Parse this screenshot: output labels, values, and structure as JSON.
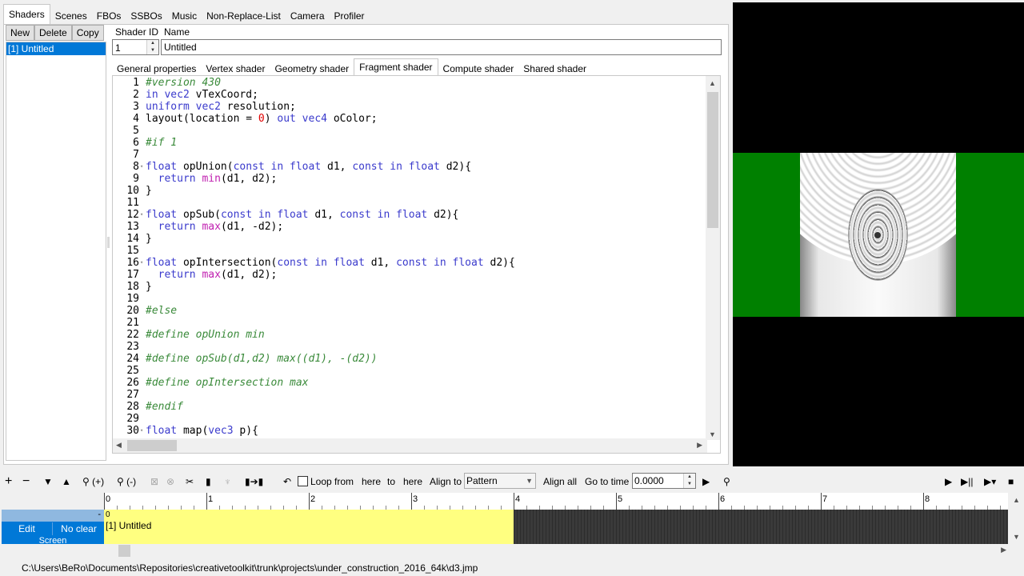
{
  "main_tabs": [
    "Shaders",
    "Scenes",
    "FBOs",
    "SSBOs",
    "Music",
    "Non-Replace-List",
    "Camera",
    "Profiler"
  ],
  "main_tab_active": "Shaders",
  "list_buttons": {
    "new": "New",
    "delete": "Delete",
    "copy": "Copy"
  },
  "shader_list": [
    "[1] Untitled"
  ],
  "header": {
    "shader_id_label": "Shader ID",
    "name_label": "Name",
    "shader_id_value": "1",
    "name_value": "Untitled"
  },
  "sub_tabs": [
    "General properties",
    "Vertex shader",
    "Geometry shader",
    "Fragment shader",
    "Compute shader",
    "Shared shader"
  ],
  "sub_tab_active": "Fragment shader",
  "code_lines": [
    [
      [
        "pp",
        "#version 430"
      ]
    ],
    [
      [
        "kw",
        "in vec2 "
      ],
      [
        "plain",
        "vTexCoord;"
      ]
    ],
    [
      [
        "kw",
        "uniform vec2 "
      ],
      [
        "plain",
        "resolution;"
      ]
    ],
    [
      [
        "plain",
        "layout(location = "
      ],
      [
        "num",
        "0"
      ],
      [
        "plain",
        ") "
      ],
      [
        "kw",
        "out vec4 "
      ],
      [
        "plain",
        "oColor;"
      ]
    ],
    [],
    [
      [
        "pp",
        "#if 1"
      ]
    ],
    [],
    [
      [
        "kw",
        "float "
      ],
      [
        "plain",
        "opUnion("
      ],
      [
        "kw",
        "const in float "
      ],
      [
        "plain",
        "d1, "
      ],
      [
        "kw",
        "const in float "
      ],
      [
        "plain",
        "d2){"
      ]
    ],
    [
      [
        "plain",
        "  "
      ],
      [
        "kw",
        "return "
      ],
      [
        "fn",
        "min"
      ],
      [
        "plain",
        "(d1, d2);"
      ]
    ],
    [
      [
        "plain",
        "}"
      ]
    ],
    [],
    [
      [
        "kw",
        "float "
      ],
      [
        "plain",
        "opSub("
      ],
      [
        "kw",
        "const in float "
      ],
      [
        "plain",
        "d1, "
      ],
      [
        "kw",
        "const in float "
      ],
      [
        "plain",
        "d2){"
      ]
    ],
    [
      [
        "plain",
        "  "
      ],
      [
        "kw",
        "return "
      ],
      [
        "fn",
        "max"
      ],
      [
        "plain",
        "(d1, -d2);"
      ]
    ],
    [
      [
        "plain",
        "}"
      ]
    ],
    [],
    [
      [
        "kw",
        "float "
      ],
      [
        "plain",
        "opIntersection("
      ],
      [
        "kw",
        "const in float "
      ],
      [
        "plain",
        "d1, "
      ],
      [
        "kw",
        "const in float "
      ],
      [
        "plain",
        "d2){"
      ]
    ],
    [
      [
        "plain",
        "  "
      ],
      [
        "kw",
        "return "
      ],
      [
        "fn",
        "max"
      ],
      [
        "plain",
        "(d1, d2);"
      ]
    ],
    [
      [
        "plain",
        "}"
      ]
    ],
    [],
    [
      [
        "pp",
        "#else"
      ]
    ],
    [],
    [
      [
        "pp",
        "#define opUnion min"
      ]
    ],
    [],
    [
      [
        "pp",
        "#define opSub(d1,d2) max((d1), -(d2))"
      ]
    ],
    [],
    [
      [
        "pp",
        "#define opIntersection max"
      ]
    ],
    [],
    [
      [
        "pp",
        "#endif"
      ]
    ],
    [],
    [
      [
        "kw",
        "float "
      ],
      [
        "plain",
        "map("
      ],
      [
        "kw",
        "vec3 "
      ],
      [
        "plain",
        "p){"
      ]
    ]
  ],
  "fold_lines": [
    8,
    12,
    16,
    30
  ],
  "toolbar": {
    "loop_from": "Loop from",
    "here1": "here",
    "to": "to",
    "here2": "here",
    "align_to": "Align to",
    "align_value": "Pattern",
    "align_all": "Align all",
    "go_to_time": "Go to time",
    "time_value": "0.0000",
    "zoom_in": "(+)",
    "zoom_out": "(-)"
  },
  "ruler_labels": [
    "0",
    "1",
    "2",
    "3",
    "4",
    "5",
    "6",
    "7",
    "8"
  ],
  "track": {
    "edit": "Edit",
    "no_clear": "No clear",
    "screen": "Screen",
    "minus": "-"
  },
  "clip": {
    "start": "0",
    "label": "[1] Untitled"
  },
  "status_path": "C:\\Users\\BeRo\\Documents\\Repositories\\creativetoolkit\\trunk\\projects\\under_construction_2016_64k\\d3.jmp",
  "colors": {
    "accent": "#0078d7",
    "clip": "#ffff80",
    "preview_green": "#008000"
  }
}
